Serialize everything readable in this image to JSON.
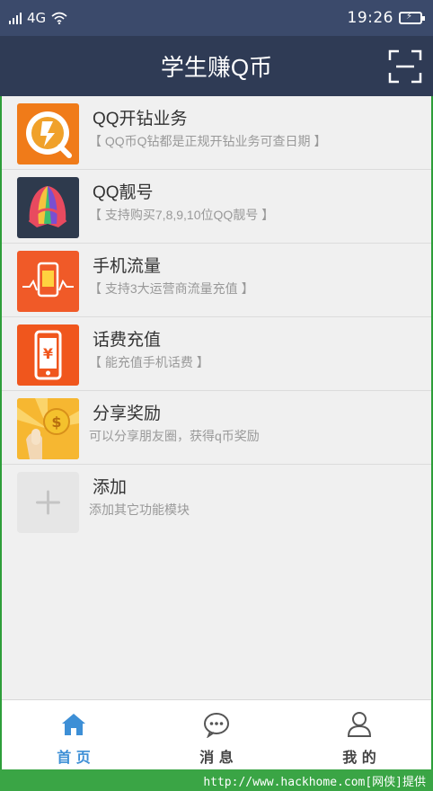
{
  "status_bar": {
    "network": "4G",
    "time": "19:26",
    "battery_glyph": "⚡"
  },
  "header": {
    "title": "学生赚Q币"
  },
  "list": [
    {
      "title": "QQ开钻业务",
      "subtitle": "【 QQ币Q钻都是正规开钻业务可查日期 】",
      "icon": "qq-diamond-icon"
    },
    {
      "title": "QQ靓号",
      "subtitle": "【 支持购买7,8,9,10位QQ靓号 】",
      "icon": "qq-pretty-number-icon"
    },
    {
      "title": "手机流量",
      "subtitle": "【 支持3大运营商流量充值 】",
      "icon": "mobile-data-icon"
    },
    {
      "title": "话费充值",
      "subtitle": "【 能充值手机话费 】",
      "icon": "phone-bill-icon"
    },
    {
      "title": "分享奖励",
      "subtitle": "可以分享朋友圈，获得q币奖励",
      "icon": "share-reward-icon"
    },
    {
      "title": "添加",
      "subtitle": "添加其它功能模块",
      "icon": "plus-icon"
    }
  ],
  "tabs": [
    {
      "label": "首 页",
      "icon": "home-icon",
      "active": true
    },
    {
      "label": "消 息",
      "icon": "message-icon",
      "active": false
    },
    {
      "label": "我 的",
      "icon": "profile-icon",
      "active": false
    }
  ],
  "footer": {
    "watermark": "http://www.hackhome.com[网侠]提供"
  },
  "colors": {
    "header": "#2f3b55",
    "active_tab": "#3d8fd6",
    "inactive_tab": "#444444",
    "footer": "#3aa545"
  }
}
